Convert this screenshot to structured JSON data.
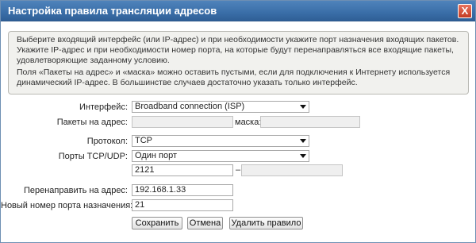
{
  "window": {
    "title": "Настройка правила трансляции адресов",
    "close_label": "X"
  },
  "info": {
    "paragraph1": "Выберите входящий интерфейс (или IP-адрес) и при необходимости укажите порт назначения входящих пакетов. Укажите IP-адрес и при необходимости номер порта, на которые будут перенаправляться все входящие пакеты, удовлетворяющие заданному условию.",
    "paragraph2": "Поля «Пакеты на адрес» и «маска» можно оставить пустыми, если для подключения к Интернету используется динамический IP-адрес. В большинстве случаев достаточно указать только интерфейс."
  },
  "form": {
    "interface_label": "Интерфейс:",
    "interface_value": "Broadband connection (ISP)",
    "packets_label": "Пакеты на адрес:",
    "packets_value": "",
    "mask_label": "маска:",
    "mask_value": "",
    "protocol_label": "Протокол:",
    "protocol_value": "TCP",
    "ports_label": "Порты TCP/UDP:",
    "ports_value": "Один порт",
    "port_from": "2121",
    "port_separator": "–",
    "port_to": "",
    "redirect_label": "Перенаправить на адрес:",
    "redirect_value": "192.168.1.33",
    "new_port_label": "Новый номер порта назначения:",
    "new_port_value": "21"
  },
  "buttons": {
    "save": "Сохранить",
    "cancel": "Отмена",
    "delete": "Удалить правило"
  },
  "colors": {
    "titlebar": "#3a6ea8",
    "close": "#c33b23"
  }
}
